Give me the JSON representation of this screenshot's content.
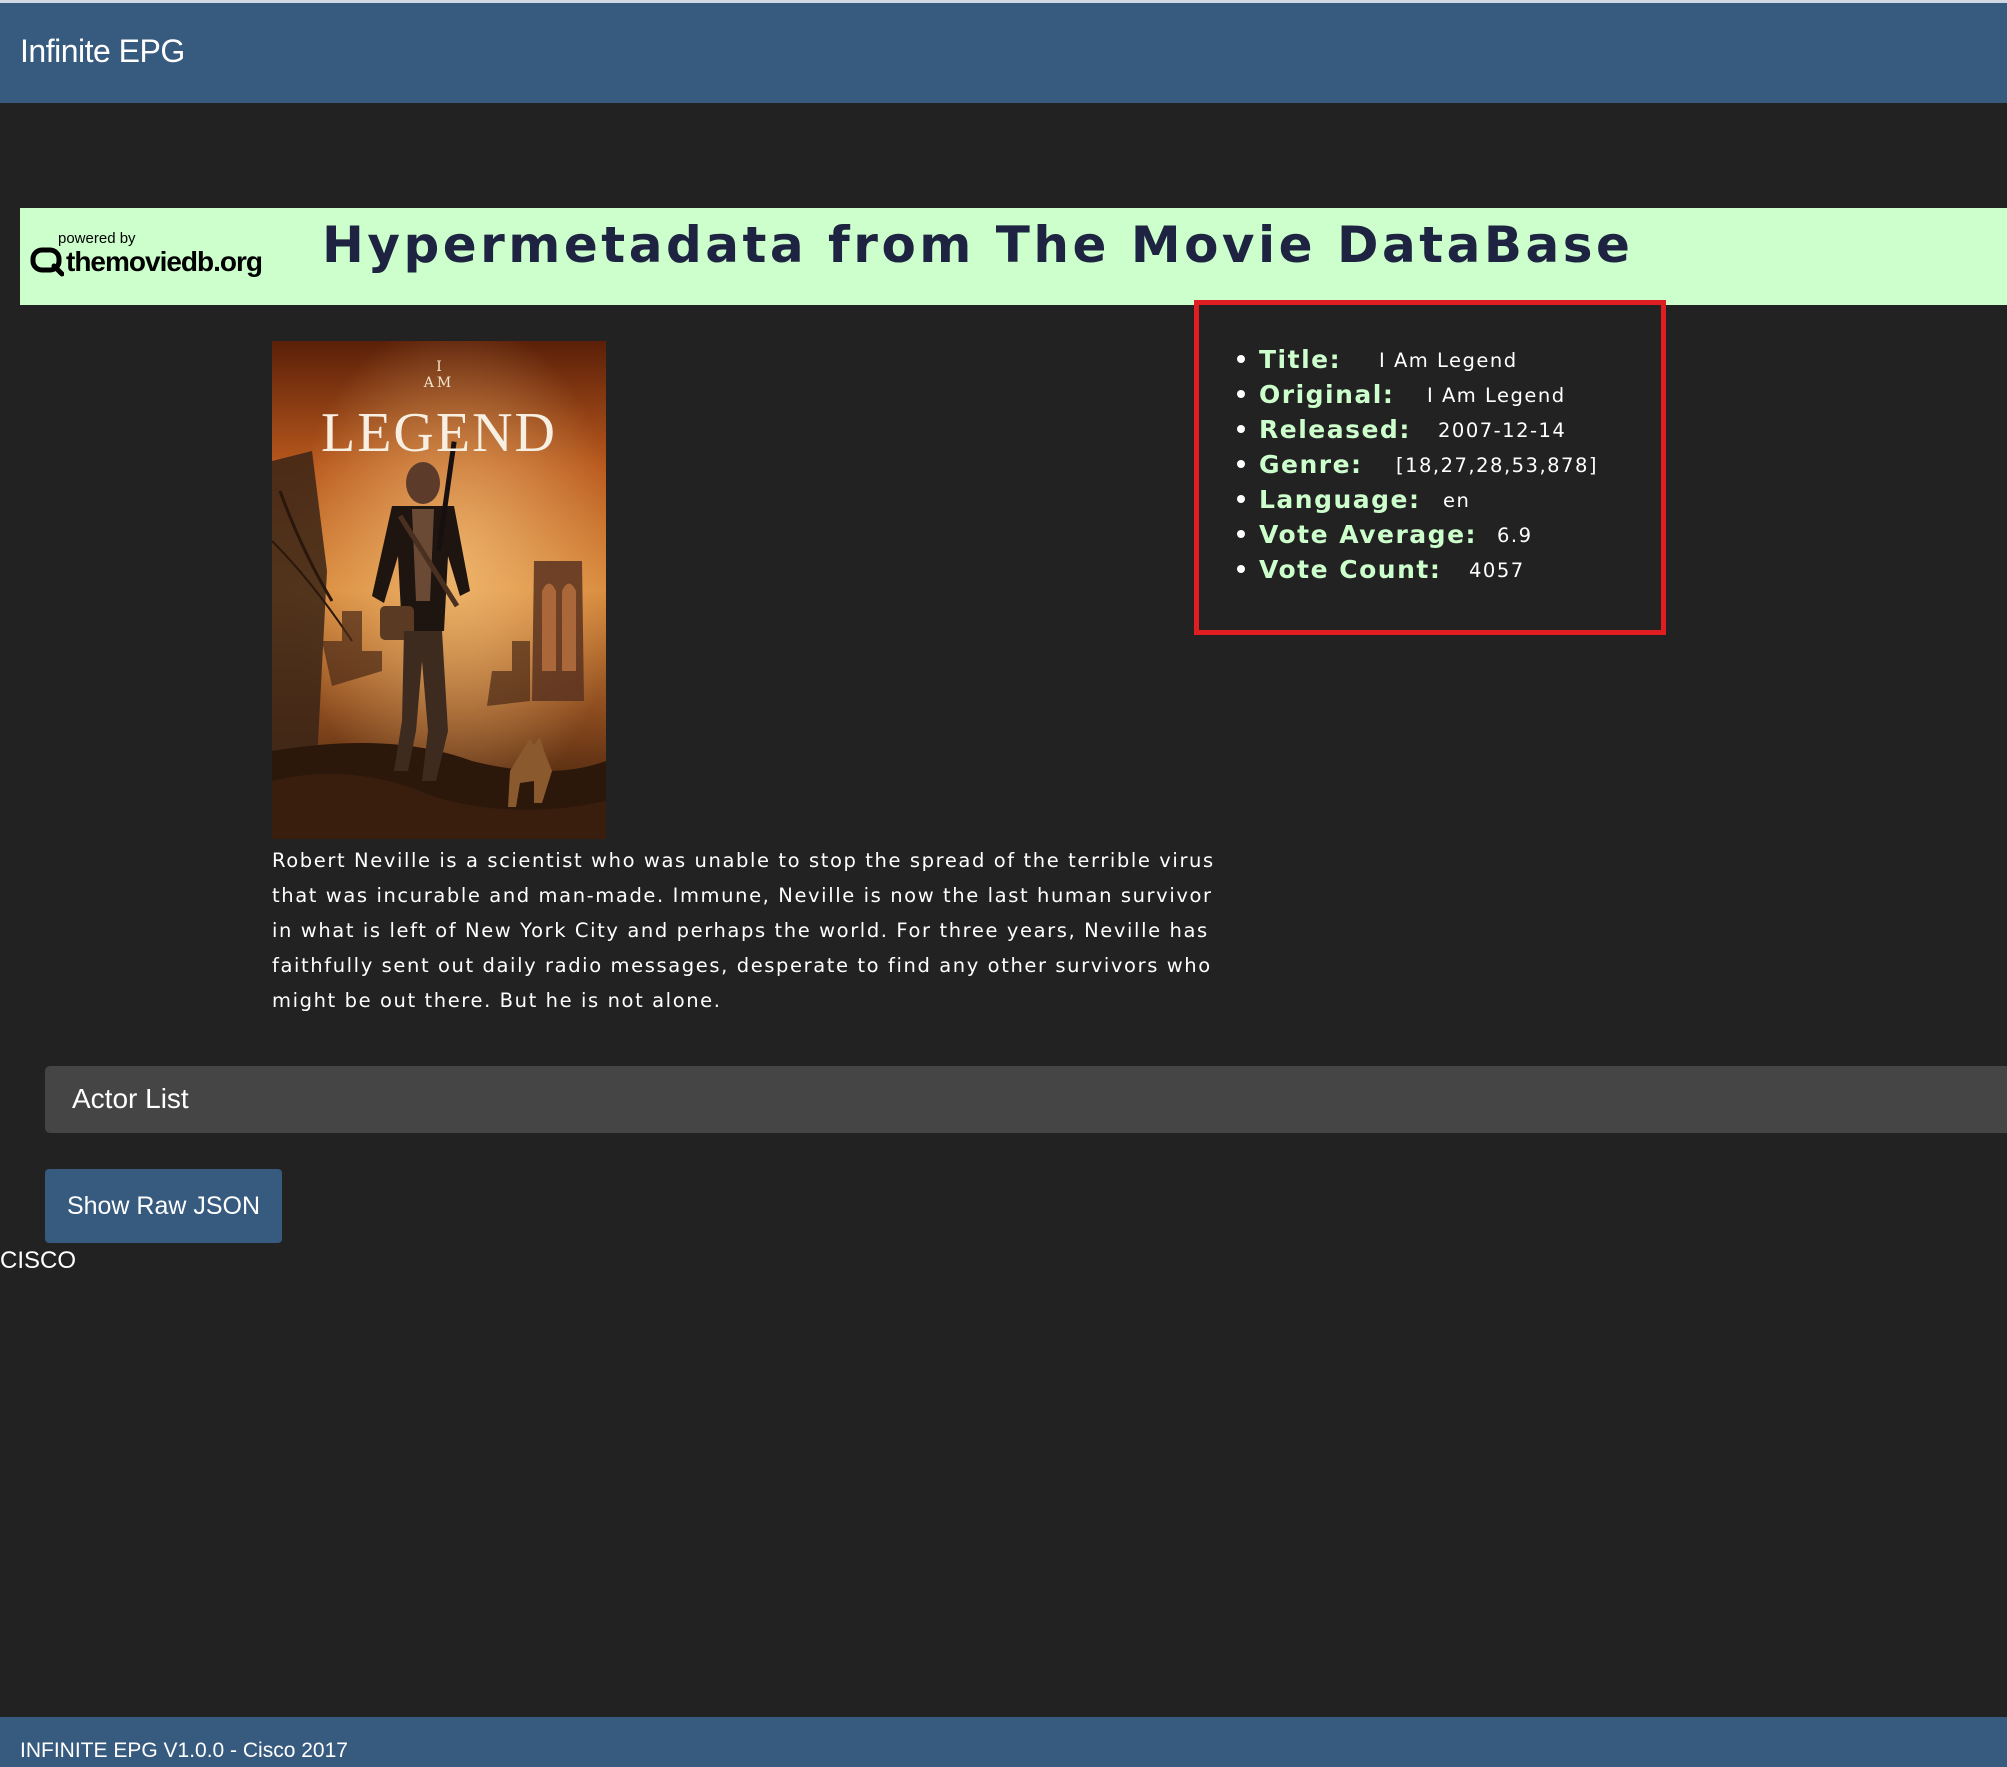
{
  "navbar": {
    "brand": "Infinite EPG"
  },
  "banner": {
    "logo_powered_by": "powered by",
    "logo_name": "themoviedb.org",
    "title": "Hypermetadata from The Movie DataBase"
  },
  "movie": {
    "poster": {
      "top_small": "I",
      "top_mid": "AM",
      "title_word": "LEGEND"
    },
    "overview": "Robert Neville is a scientist who was unable to stop the spread of the terrible virus that was incurable and man-made. Immune, Neville is now the last human survivor in what is left of New York City and perhaps the world. For three years, Neville has faithfully sent out daily radio messages, desperate to find any other survivors who might be out there. But he is not alone.",
    "details": [
      {
        "key": "Title:",
        "value": "I Am Legend"
      },
      {
        "key": "Original:",
        "value": "I Am Legend"
      },
      {
        "key": "Released:",
        "value": "2007-12-14"
      },
      {
        "key": "Genre:",
        "value": "[18,27,28,53,878]"
      },
      {
        "key": "Language:",
        "value": "en"
      },
      {
        "key": "Vote Average:",
        "value": "6.9"
      },
      {
        "key": "Vote Count:",
        "value": "4057"
      }
    ]
  },
  "actor_panel": {
    "title": "Actor List"
  },
  "raw_json_button": {
    "label": "Show Raw JSON"
  },
  "company_label": "CISCO",
  "footer": {
    "text": "INFINITE EPG V1.0.0 - Cisco 2017"
  },
  "colors": {
    "navbar": "#375a7f",
    "banner": "#ccffcc",
    "detail_key": "#ccffcc",
    "highlight_border": "#e01e22",
    "page_background": "#222222",
    "panel": "#464545"
  }
}
